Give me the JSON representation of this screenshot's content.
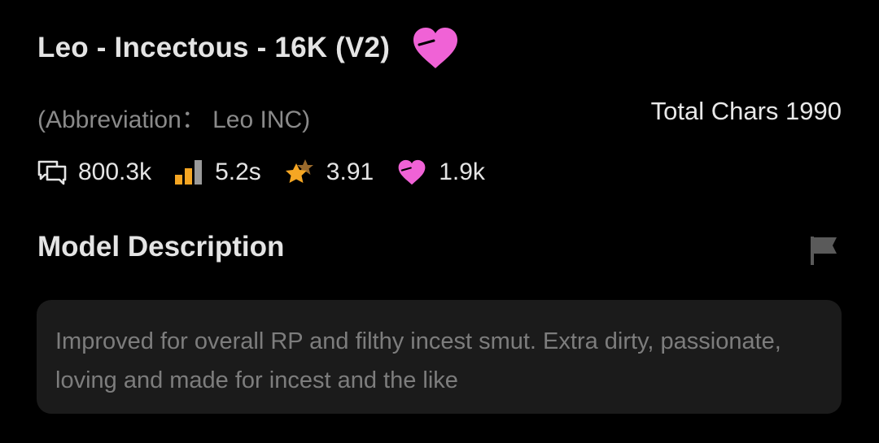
{
  "model": {
    "title": "Leo - Incectous - 16K (V2)",
    "abbreviation": "(Abbreviation： Leo INC)",
    "total_chars": "Total Chars 1990"
  },
  "stats": {
    "chats": "800.3k",
    "response_time": "5.2s",
    "rating": "3.91",
    "likes": "1.9k"
  },
  "description": {
    "section_title": "Model Description",
    "text": "Improved for overall RP and filthy incest smut. Extra dirty, passionate, loving and made for incest and the like"
  },
  "icons": {
    "favorite": "heart-icon",
    "chats": "chat-bubbles-icon",
    "response_time": "signal-bars-icon",
    "rating": "stars-icon",
    "likes": "heart-icon",
    "report": "flag-icon"
  },
  "colors": {
    "background": "#000000",
    "heart": "#f062d6",
    "bars": "#f5a623",
    "star_front": "#f5a623",
    "star_back": "#9a6a2c",
    "description_box": "#1b1b1b",
    "muted_text": "#8a8a8a"
  }
}
